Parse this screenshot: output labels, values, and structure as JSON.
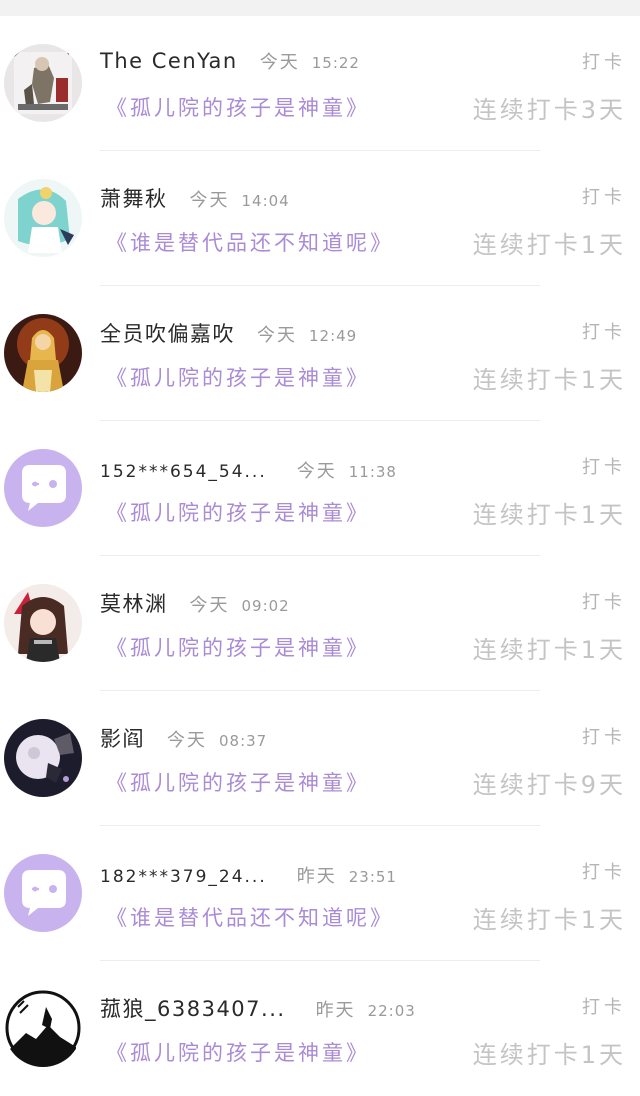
{
  "colors": {
    "book_title": "#a98bd6",
    "muted": "#9a9a9a",
    "chat_avatar_bg": "#c9b3ee",
    "chat_bubble": "#ffffff"
  },
  "rows": [
    {
      "name": "The CenYan",
      "day": "今天",
      "time": "15:22",
      "label": "打卡",
      "book": "《孤儿院的孩子是神童》",
      "streak": "连续打卡3天",
      "avatar": "illustrated-character"
    },
    {
      "name": "萧舞秋",
      "day": "今天",
      "time": "14:04",
      "label": "打卡",
      "book": "《谁是替代品还不知道呢》",
      "streak": "连续打卡1天",
      "avatar": "anime-character"
    },
    {
      "name": "全员吹偏嘉吹",
      "day": "今天",
      "time": "12:49",
      "label": "打卡",
      "book": "《孤儿院的孩子是神童》",
      "streak": "连续打卡1天",
      "avatar": "golden-figure"
    },
    {
      "name": "152***654_54...",
      "day": "今天",
      "time": "11:38",
      "label": "打卡",
      "book": "《孤儿院的孩子是神童》",
      "streak": "连续打卡1天",
      "avatar": "default-chat-icon"
    },
    {
      "name": "莫林渊",
      "day": "今天",
      "time": "09:02",
      "label": "打卡",
      "book": "《孤儿院的孩子是神童》",
      "streak": "连续打卡1天",
      "avatar": "anime-girl"
    },
    {
      "name": "影阎",
      "day": "今天",
      "time": "08:37",
      "label": "打卡",
      "book": "《孤儿院的孩子是神童》",
      "streak": "连续打卡9天",
      "avatar": "moon-night"
    },
    {
      "name": "182***379_24...",
      "day": "昨天",
      "time": "23:51",
      "label": "打卡",
      "book": "《谁是替代品还不知道呢》",
      "streak": "连续打卡1天",
      "avatar": "default-chat-icon"
    },
    {
      "name": "菰狼_6383407...",
      "day": "昨天",
      "time": "22:03",
      "label": "打卡",
      "book": "《孤儿院的孩子是神童》",
      "streak": "连续打卡1天",
      "avatar": "wolf-moon"
    }
  ]
}
